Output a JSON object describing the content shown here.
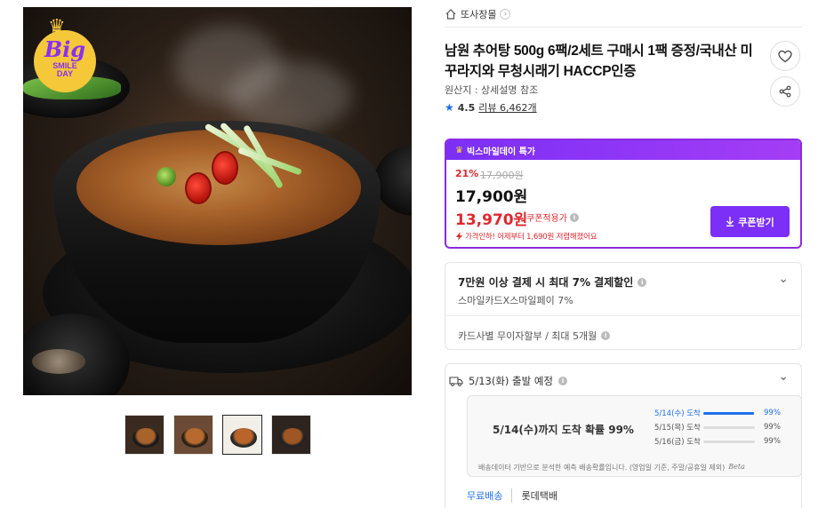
{
  "badge": {
    "big": "Big",
    "sub_line1": "SMILE",
    "sub_line2": "DAY"
  },
  "thumbnails": [
    {
      "label": "thumbnail-1",
      "bg": "#3a2a20",
      "bowl": "#1a1a1a",
      "soup": "#a8632b"
    },
    {
      "label": "thumbnail-2",
      "bg": "#6b4b35",
      "bowl": "#2d2118",
      "soup": "#b66a2e"
    },
    {
      "label": "thumbnail-3",
      "bg": "#f2efe9",
      "bowl": "#2a2a2a",
      "soup": "#b8642a"
    },
    {
      "label": "thumbnail-4",
      "bg": "#2d2420",
      "bowl": "#222",
      "soup": "#9e5624"
    }
  ],
  "category": {
    "label": "또사장몰",
    "arrow": "›"
  },
  "product": {
    "title": "남원 추어탕 500g 6팩/2세트 구매시 1팩 증정/국내산 미꾸라지와 무청시래기 HACCP인증",
    "origin": "원산지 : 상세설명 참조",
    "rating": "4.5",
    "review_label": "리뷰 6,462개"
  },
  "deal": {
    "header": "빅스마일데이 특가",
    "discount_rate": "21%",
    "original_price": "17,900원",
    "sale_price": "17,900원",
    "coupon_price": "13,970원",
    "coupon_label": "쿠폰적용가",
    "price_drop": "가격인하! 어제부터 1,690원 저렴해졌어요",
    "coupon_button": "쿠폰받기"
  },
  "payment": {
    "title": "7만원 이상 결제 시 최대 7% 결제할인",
    "sub": "스마일카드X스마일페이 7%",
    "installment": "카드사별 무이자할부 / 최대 5개월"
  },
  "shipping": {
    "title": "5/13(화) 출발 예정",
    "forecast_msg": "5/14(수)까지 도착 확률 99%",
    "probabilities": [
      {
        "day": "5/14(수) 도착",
        "pct": "99%",
        "value": 0.99,
        "hot": true
      },
      {
        "day": "5/15(목) 도착",
        "pct": "99%",
        "value": 0.0,
        "hot": false
      },
      {
        "day": "5/16(금) 도착",
        "pct": "99%",
        "value": 0.0,
        "hot": false
      }
    ],
    "note": "배송데이터 기반으로 분석한 예측 배송확률입니다. (영업일 기준, 주말/공휴일 제외)",
    "beta": "Beta",
    "free_shipping": "무료배송",
    "carrier": "롯데택배"
  },
  "colors": {
    "accent": "#7b2ff7",
    "sale": "#e0272e",
    "link": "#1e6fe8"
  }
}
